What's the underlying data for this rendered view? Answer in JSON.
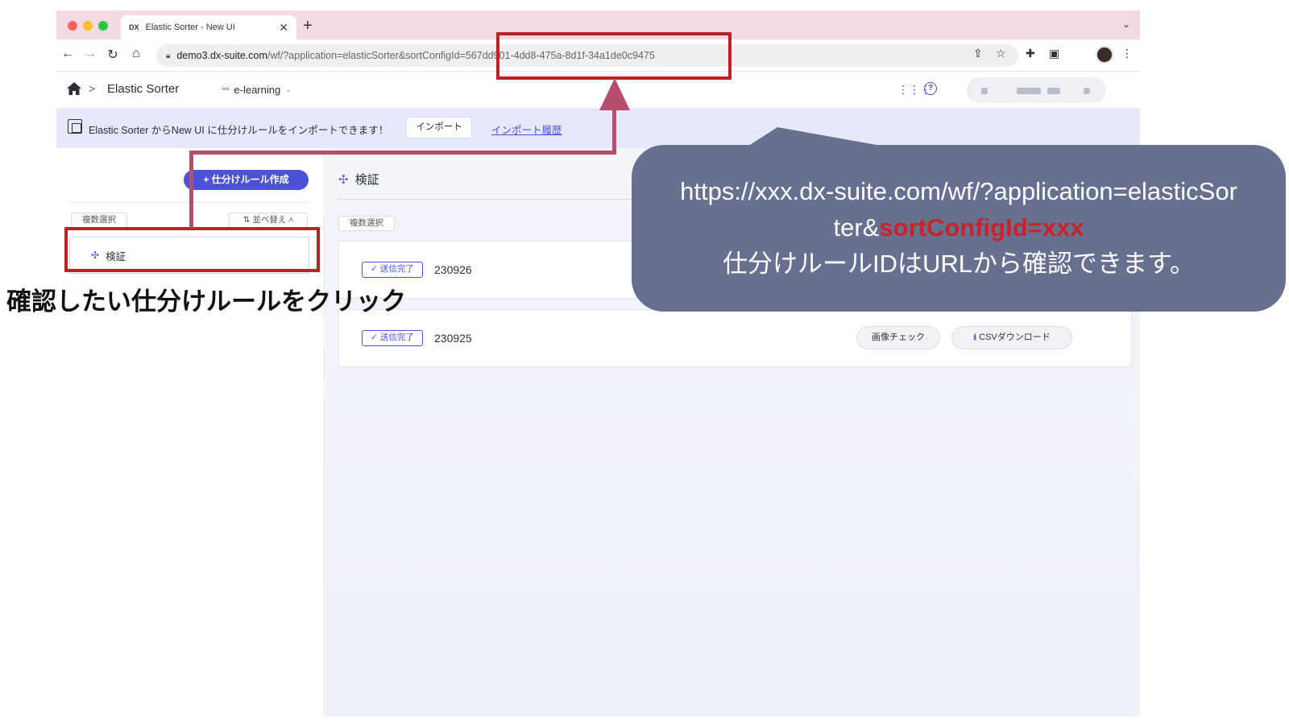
{
  "browser": {
    "tab": {
      "favicon": "DX",
      "title": "Elastic Sorter - New UI",
      "close": "✕"
    },
    "new_tab": "+",
    "url": {
      "host": "demo3.dx-suite.com",
      "path": "/wf/?application=elasticSorter&sortConfigId=567dd901-4dd8-475a-8d1f-34a1de0c9475"
    }
  },
  "header": {
    "separator": ">",
    "app_name": "Elastic Sorter",
    "workspace": "e-learning"
  },
  "banner": {
    "text": "Elastic Sorter からNew UI に仕分けルールをインポートできます！",
    "import_button": "インポート",
    "history_link": "インポート履歴"
  },
  "sidebar": {
    "create_button": "+ 仕分けルール作成",
    "multi_select": "複数選択",
    "sort_button": "並べ替え",
    "items": [
      {
        "label": "検証"
      }
    ]
  },
  "main": {
    "title": "検証",
    "multi_select": "複数選択",
    "rows": [
      {
        "status": "✓ 送信完了",
        "name": "230926"
      },
      {
        "status": "✓ 送信完了",
        "name": "230925",
        "image_check": "画像チェック",
        "csv_download": "CSVダウンロード"
      }
    ]
  },
  "annotation": {
    "callout_line1": "https://xxx.dx-suite.com/wf/?application=elasticSor",
    "callout_line2_prefix": "ter&",
    "callout_line2_highlight": "sortConfigId=xxx",
    "callout_line3": "仕分けルールIDはURLから確認できます。",
    "caption": "確認したい仕分けルールをクリック"
  },
  "colors": {
    "accent": "#4b52d6",
    "highlight_red": "#b42526",
    "callout_bg": "#687090",
    "tabbar": "#f3d9e3",
    "banner_bg": "#e5e9fa"
  }
}
